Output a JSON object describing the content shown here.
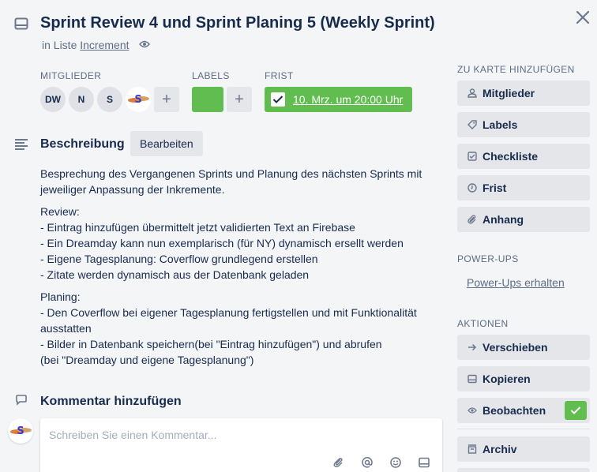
{
  "card": {
    "title": "Sprint Review 4 und Sprint Planing 5 (Weekly Sprint)",
    "in_list_prefix": "in Liste",
    "list_name": "Increment"
  },
  "members": {
    "label": "MITGLIEDER",
    "initials": [
      "DW",
      "N",
      "S"
    ]
  },
  "labels": {
    "label": "LABELS",
    "color": "#61bd4f"
  },
  "due": {
    "label": "FRIST",
    "value": "10. Mrz. um 20:00 Uhr",
    "complete": true
  },
  "description": {
    "heading": "Beschreibung",
    "edit_label": "Bearbeiten",
    "paragraphs": [
      [
        "Besprechung des Vergangenen Sprints und Planung des nächsten Sprints mit",
        "jeweiliger Anpassung der Inkremente."
      ],
      [
        "Review:",
        "- Eintrag hinzufügen übermittelt jetzt validierten Text an Firebase",
        "- Ein Dreamday kann nun exemplarisch (für NY) dynamisch ersellt werden",
        "- Eigene Tagesplanung: Coverflow grundlegend erstellen",
        "- Zitate werden dynamisch aus der Datenbank geladen"
      ],
      [
        "Planing:",
        "- Den Coverflow bei eigener Tagesplanung fertigstellen und mit Funktionalität",
        "ausstatten",
        "- Bilder in Datenbank speichern(bei \"Eintrag hinzufügen\") und abrufen",
        "(bei \"Dreamday und eigene Tagesplanung\")"
      ]
    ]
  },
  "comment": {
    "heading": "Kommentar hinzufügen",
    "placeholder": "Schreiben Sie einen Kommentar..."
  },
  "sidebar": {
    "add_to_card_label": "ZU KARTE HINZUFÜGEN",
    "add_buttons": [
      {
        "label": "Mitglieder",
        "icon": "person-icon"
      },
      {
        "label": "Labels",
        "icon": "label-icon"
      },
      {
        "label": "Checkliste",
        "icon": "checklist-icon"
      },
      {
        "label": "Frist",
        "icon": "clock-icon"
      },
      {
        "label": "Anhang",
        "icon": "attachment-icon"
      }
    ],
    "powerups_label": "POWER-UPS",
    "powerups_link": "Power-Ups erhalten",
    "actions_label": "AKTIONEN",
    "actions": [
      {
        "label": "Verschieben",
        "icon": "arrow-right-icon"
      },
      {
        "label": "Kopieren",
        "icon": "copy-icon"
      },
      {
        "label": "Beobachten",
        "icon": "eye-icon"
      },
      {
        "label": "Archiv",
        "icon": "archive-icon"
      }
    ]
  },
  "colors": {
    "green": "#61bd4f",
    "button_bg": "#e4e6ea",
    "text": "#172b4d",
    "muted": "#5e6c84"
  }
}
